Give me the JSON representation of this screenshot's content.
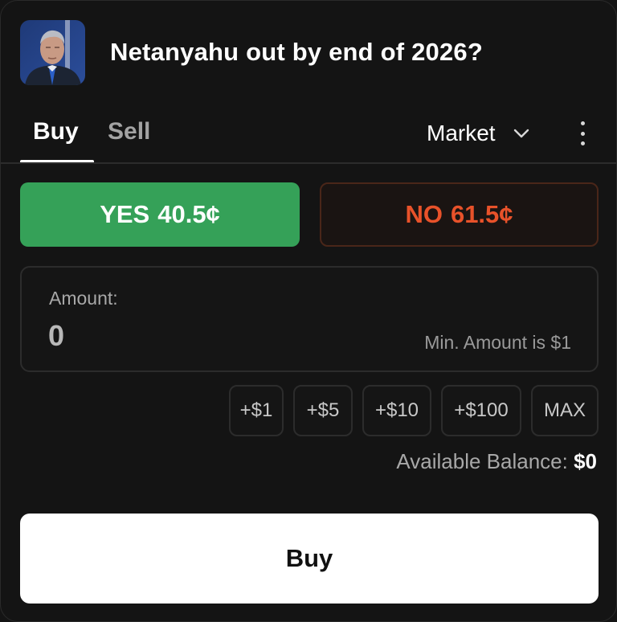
{
  "header": {
    "title": "Netanyahu out by end of 2026?",
    "avatar_icon": "market-avatar-portrait"
  },
  "tabs": {
    "buy_label": "Buy",
    "sell_label": "Sell",
    "active": "Buy"
  },
  "order_type": {
    "selected": "Market",
    "dropdown_icon": "chevron-down-icon",
    "more_icon": "more-vertical-icon"
  },
  "outcomes": {
    "yes_label": "YES",
    "yes_price": "40.5¢",
    "no_label": "NO",
    "no_price": "61.5¢",
    "selected": "YES",
    "yes_color": "#35a158",
    "no_color": "#e8522a"
  },
  "amount": {
    "label": "Amount:",
    "value": "0",
    "min_hint": "Min. Amount is $1"
  },
  "quick_amounts": [
    "+$1",
    "+$5",
    "+$10",
    "+$100",
    "MAX"
  ],
  "balance": {
    "label": "Available Balance:",
    "value": "$0"
  },
  "submit": {
    "label": "Buy"
  }
}
